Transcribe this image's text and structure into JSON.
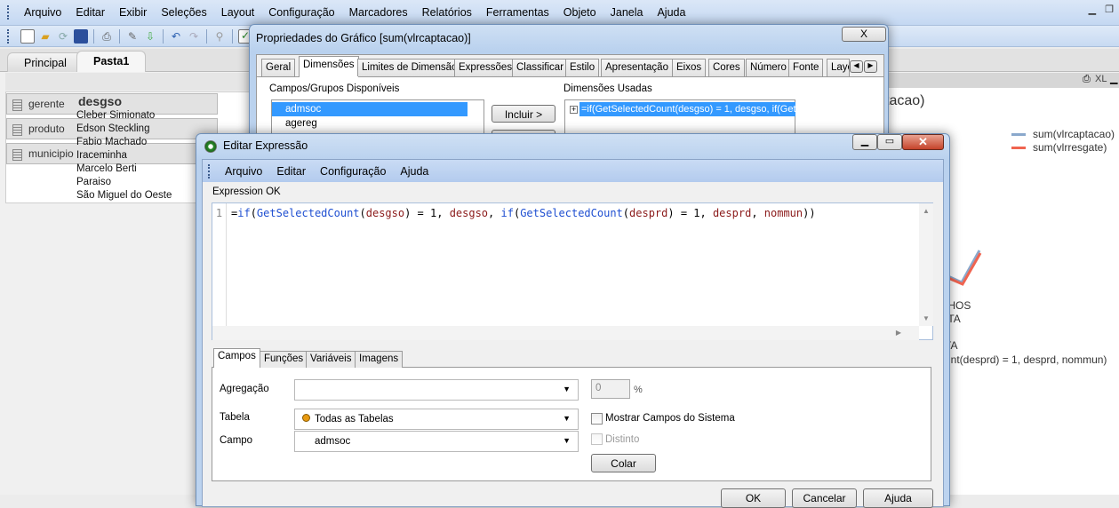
{
  "menubar": {
    "items": [
      "Arquivo",
      "Editar",
      "Exibir",
      "Seleções",
      "Layout",
      "Configuração",
      "Marcadores",
      "Relatórios",
      "Ferramentas",
      "Objeto",
      "Janela",
      "Ajuda"
    ]
  },
  "sheet_tabs": [
    {
      "label": "Principal",
      "active": false
    },
    {
      "label": "Pasta1",
      "active": true
    }
  ],
  "multibox": {
    "fields": [
      "gerente",
      "produto",
      "municipio"
    ]
  },
  "listbox": {
    "title": "desgso",
    "items": [
      "Cleber Simionato",
      "Edson Steckling",
      "Fabio Machado",
      "Iraceminha",
      "Marcelo Berti",
      "Paraiso",
      "São Miguel do Oeste"
    ]
  },
  "chart": {
    "caption_icons": [
      "print-icon",
      "XL",
      "minimize-icon"
    ],
    "xl_label": "XL",
    "title_fragment": "tacao)",
    "legend": [
      {
        "name": "sum(vlrcaptacao)",
        "color": "#8aa8cc"
      },
      {
        "name": "sum(vlrresgate)",
        "color": "#f06450"
      }
    ],
    "label_fragments": [
      "IHOS",
      "ITA",
      "TA",
      "unt(desprd) = 1, desprd, nommun)"
    ]
  },
  "props": {
    "title": "Propriedades do Gráfico [sum(vlrcaptacao)]",
    "close": "X",
    "tabs": [
      "Geral",
      "Dimensões",
      "Limites de Dimensão",
      "Expressões",
      "Classificar",
      "Estilo",
      "Apresentação",
      "Eixos",
      "Cores",
      "Número",
      "Fonte",
      "Layo"
    ],
    "active_tab": "Dimensões",
    "available_label": "Campos/Grupos Disponíveis",
    "available": [
      "admsoc",
      "agereg"
    ],
    "include_btn": "Incluir >",
    "used_label": "Dimensões Usadas",
    "used": [
      "=if(GetSelectedCount(desgso) = 1, desgso, if(Get"
    ]
  },
  "editor": {
    "title": "Editar Expressão",
    "menu": [
      "Arquivo",
      "Editar",
      "Configuração",
      "Ajuda"
    ],
    "status": "Expression OK",
    "line_number": "1",
    "code": [
      {
        "t": "=",
        "c": ""
      },
      {
        "t": "if",
        "c": "kw"
      },
      {
        "t": "(",
        "c": ""
      },
      {
        "t": "GetSelectedCount",
        "c": "kw"
      },
      {
        "t": "(",
        "c": ""
      },
      {
        "t": "desgso",
        "c": "fld"
      },
      {
        "t": ") = 1, ",
        "c": ""
      },
      {
        "t": "desgso",
        "c": "fld"
      },
      {
        "t": ", ",
        "c": ""
      },
      {
        "t": "if",
        "c": "kw"
      },
      {
        "t": "(",
        "c": ""
      },
      {
        "t": "GetSelectedCount",
        "c": "kw"
      },
      {
        "t": "(",
        "c": ""
      },
      {
        "t": "desprd",
        "c": "fld"
      },
      {
        "t": ") = 1, ",
        "c": ""
      },
      {
        "t": "desprd",
        "c": "fld"
      },
      {
        "t": ", ",
        "c": ""
      },
      {
        "t": "nommun",
        "c": "fld"
      },
      {
        "t": "))",
        "c": ""
      }
    ],
    "tabs": [
      "Campos",
      "Funções",
      "Variáveis",
      "Imagens"
    ],
    "active_tab": "Campos",
    "agregacao_label": "Agregação",
    "agregacao_value": "",
    "percent_value": "0",
    "percent_sign": "%",
    "tabela_label": "Tabela",
    "tabela_value": "Todas as Tabelas",
    "show_system_label": "Mostrar Campos do Sistema",
    "show_system_checked": false,
    "campo_label": "Campo",
    "campo_value": "admsoc",
    "distinto_label": "Distinto",
    "distinto_checked": false,
    "distinto_enabled": false,
    "colar_btn": "Colar",
    "footer_buttons": [
      "OK",
      "Cancelar",
      "Ajuda"
    ]
  }
}
